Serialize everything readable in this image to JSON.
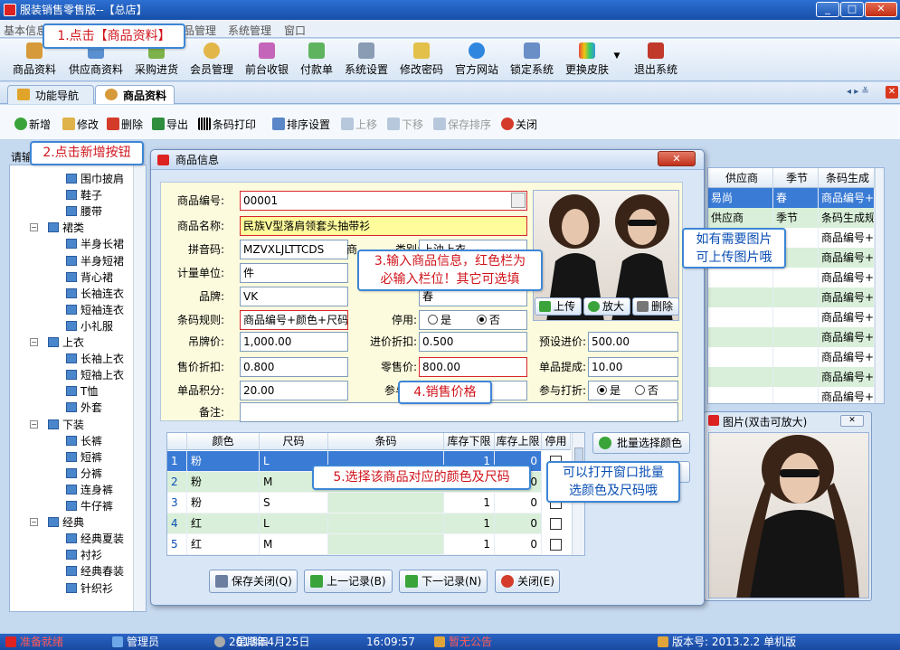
{
  "window": {
    "title": "服装销售零售版--【总店】",
    "controls": [
      "_",
      "□",
      "✕"
    ]
  },
  "menu": {
    "items": [
      "基本信息",
      "品管理",
      "系统管理",
      "窗口"
    ]
  },
  "toolbar": {
    "items": [
      "商品资料",
      "供应商资料",
      "采购进货",
      "会员管理",
      "前台收银",
      "付款单",
      "系统设置",
      "修改密码",
      "官方网站",
      "锁定系统",
      "更换皮肤",
      "退出系统"
    ]
  },
  "tabs": [
    {
      "label": "功能导航"
    },
    {
      "label": "商品资料"
    }
  ],
  "actions": {
    "add": "新增",
    "edit": "修改",
    "delete": "删除",
    "export": "导出",
    "barcode": "条码打印",
    "sort": "排序设置",
    "up": "上移",
    "down": "下移",
    "save_sort": "保存排序",
    "close": "关闭"
  },
  "search_label": "请输",
  "callouts": {
    "c1": "1.点击【商品资料】",
    "c2": "2.点击新增按钮",
    "c3_line1": "3.输入商品信息，红色栏为",
    "c3_line2": "必输入栏位！其它可选填",
    "c4": "4.销售价格",
    "c5": "5.选择该商品对应的颜色及尺码",
    "c6_line1": "如有需要图片",
    "c6_line2": "可上传图片哦",
    "c7_line1": "可以打开窗口批量",
    "c7_line2": "选颜色及尺码哦"
  },
  "tree": {
    "items": [
      "围巾披肩",
      "鞋子",
      "腰带",
      "裙类",
      "半身长裙",
      "半身短裙",
      "背心裙",
      "长袖连衣",
      "短袖连衣",
      "小礼服",
      "上衣",
      "长袖上衣",
      "短袖上衣",
      "T恤",
      "外套",
      "下装",
      "长裤",
      "短裤",
      "分裤",
      "连身裤",
      "牛仔裤",
      "经典",
      "经典夏装",
      "衬衫",
      "经典春装",
      "针织衫"
    ]
  },
  "grid": {
    "headers": [
      "供应商",
      "季节",
      "条码生成"
    ],
    "rows": [
      [
        "易尚",
        "春",
        "商品编号+颜"
      ],
      [
        "供应商",
        "季节",
        "条码生成规"
      ],
      [
        "",
        "",
        "商品编号+颜"
      ],
      [
        "",
        "",
        "商品编号+颜"
      ],
      [
        "",
        "",
        "商品编号+颜"
      ],
      [
        "",
        "",
        "商品编号+颜"
      ],
      [
        "",
        "",
        "商品编号+颜"
      ],
      [
        "",
        "",
        "商品编号+颜"
      ],
      [
        "",
        "",
        "商品编号+颜"
      ],
      [
        "",
        "",
        "商品编号+颜"
      ],
      [
        "",
        "",
        "商品编号+颜"
      ]
    ]
  },
  "dialog": {
    "title": "商品信息",
    "labels": {
      "code": "商品编号:",
      "name": "商品名称:",
      "pinyin": "拼音码:",
      "category": "类别:",
      "category_prefix": "商",
      "unit": "计量单位:",
      "brand": "品牌:",
      "supplier_hidden": "季节:",
      "barcode_rule": "条码规则:",
      "disabled": "停用:",
      "tag_price": "吊牌价:",
      "purchase_discount": "进价折扣:",
      "preset_purchase": "预设进价:",
      "sale_discount": "售价折扣:",
      "retail_price": "零售价:",
      "commission": "单品提成:",
      "points": "单品积分:",
      "in_points": "参与积",
      "in_discount": "参与打折:",
      "remark": "备注:"
    },
    "values": {
      "code": "00001",
      "name": "民族V型落肩领套头抽带衫",
      "pinyin": "MZVXLJLTTCDS",
      "category": "上油上衣",
      "unit": "件",
      "brand": "VK",
      "season": "春",
      "barcode_rule": "商品编号+颜色+尺码",
      "tag_price": "1,000.00",
      "purchase_discount": "0.500",
      "preset_purchase": "500.00",
      "sale_discount": "0.800",
      "retail_price": "800.00",
      "commission": "10.00",
      "points": "20.00",
      "remark": ""
    },
    "radio": {
      "yes": "是",
      "no": "否"
    },
    "photo_buttons": {
      "upload": "上传",
      "zoom": "放大",
      "delete": "删除"
    },
    "table": {
      "headers": [
        "颜色",
        "尺码",
        "条码",
        "库存下限",
        "库存上限",
        "停用"
      ],
      "rows": [
        {
          "no": "1",
          "color": "粉",
          "size": "L",
          "min": "1",
          "max": "0"
        },
        {
          "no": "2",
          "color": "粉",
          "size": "M",
          "min": "1",
          "max": "0"
        },
        {
          "no": "3",
          "color": "粉",
          "size": "S",
          "min": "1",
          "max": "0"
        },
        {
          "no": "4",
          "color": "红",
          "size": "L",
          "min": "1",
          "max": "0"
        },
        {
          "no": "5",
          "color": "红",
          "size": "M",
          "min": "1",
          "max": "0"
        }
      ]
    },
    "batch_button": "批量选择颜色",
    "buttons": {
      "save_close": "保存关闭(Q)",
      "prev": "上一记录(B)",
      "next": "下一记录(N)",
      "close": "关闭(E)"
    }
  },
  "picwin": {
    "title": "图片(双击可放大)",
    "close": "✕"
  },
  "status": {
    "ready": "准备就绪",
    "user": "管理员",
    "date": "2013年4月25日",
    "weekday": "星期四",
    "time": "16:09:57",
    "notice": "暂无公告",
    "version": "版本号: 2013.2.2 单机版"
  }
}
